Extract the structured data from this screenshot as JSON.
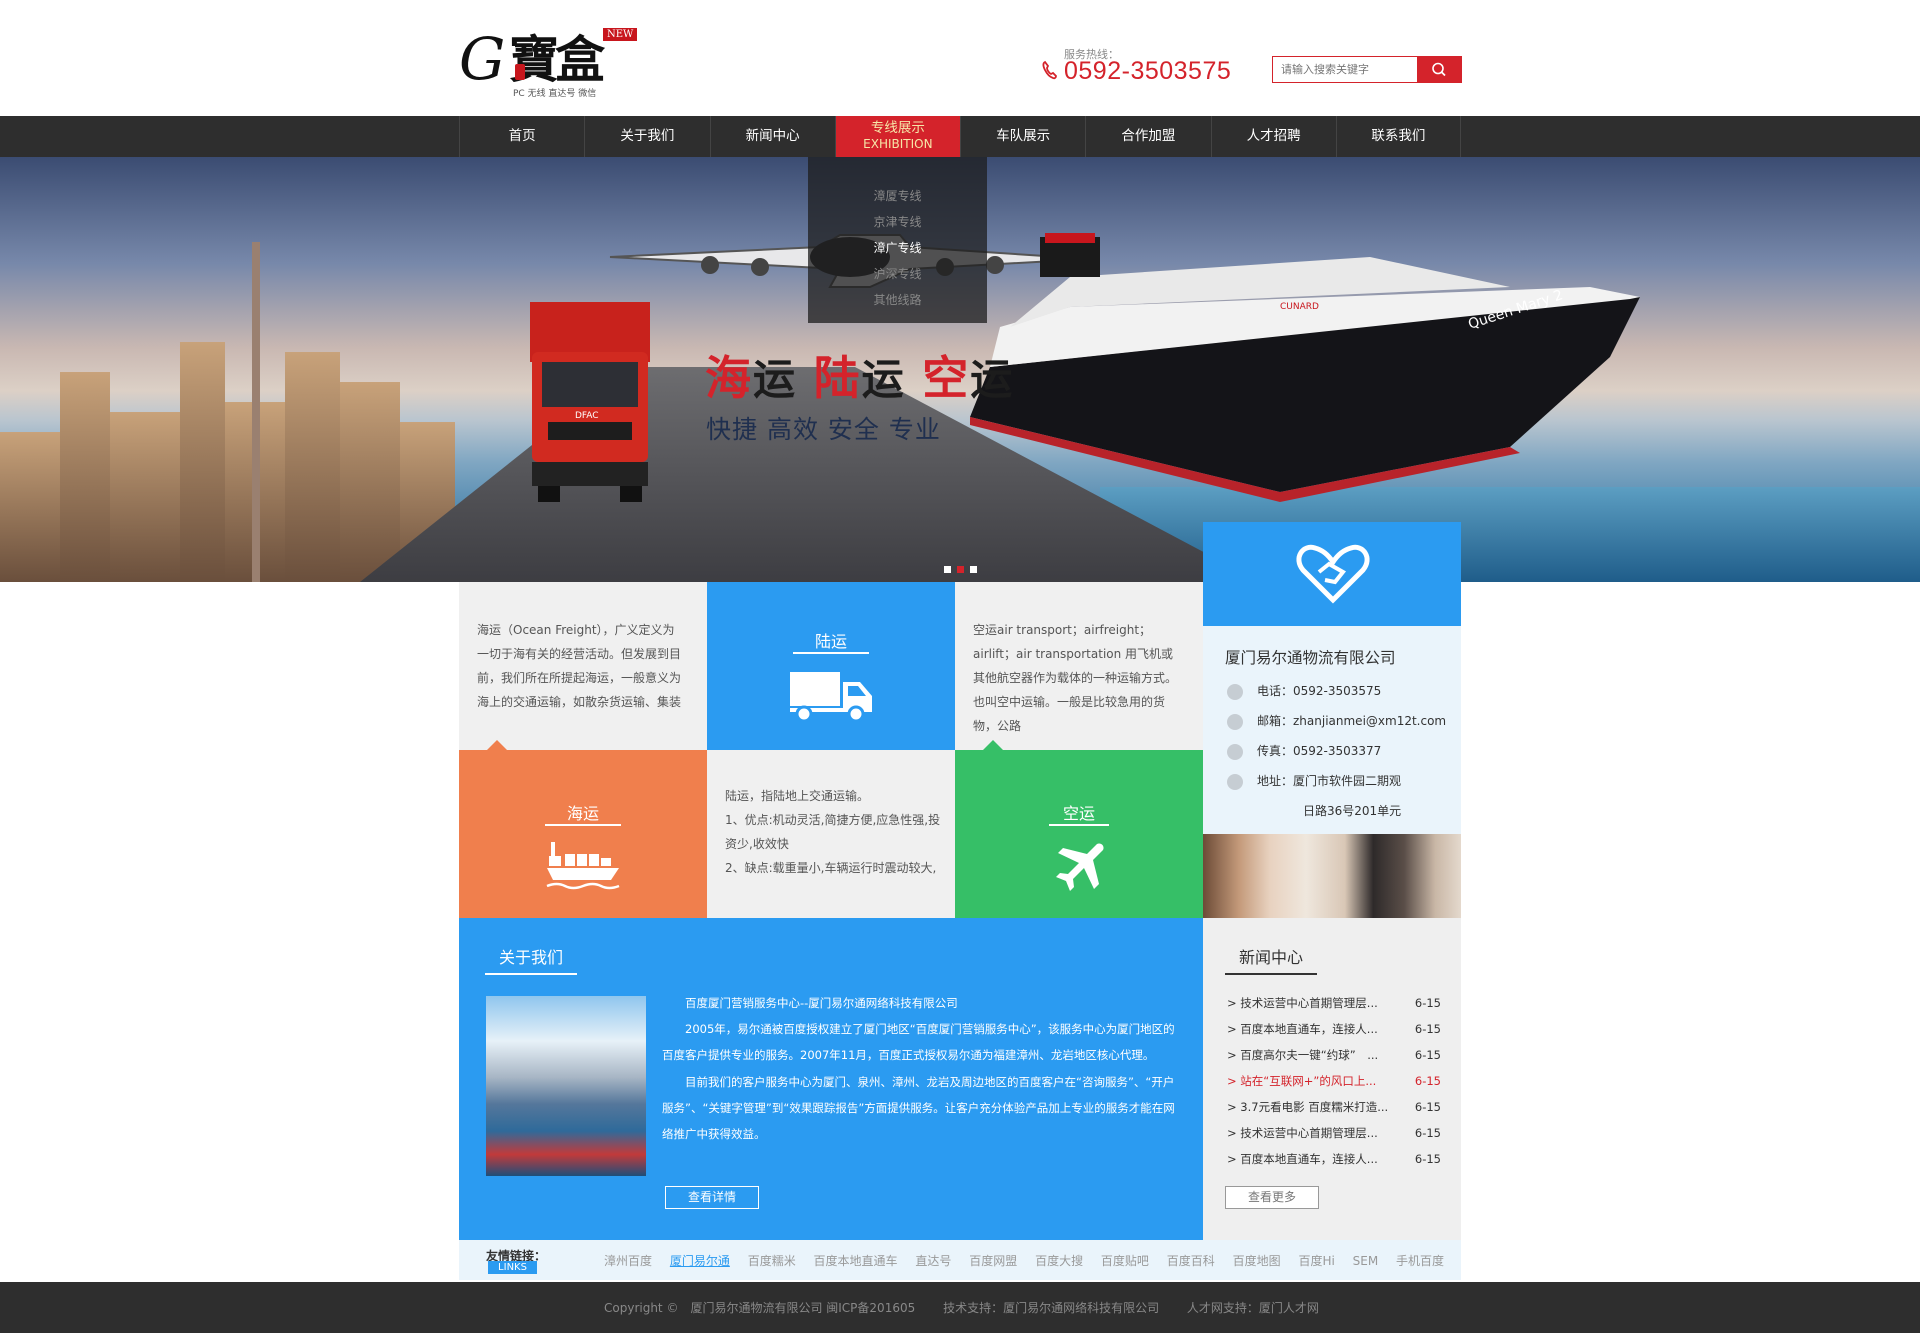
{
  "header": {
    "logo_new": "NEW",
    "logo_letter": "G",
    "logo_word": "寶盒",
    "logo_sub": "PC 无线 直达号 微信",
    "hotline_label": "服务热线：",
    "hotline_number": "0592-3503575",
    "search_placeholder": "请输入搜索关键字"
  },
  "nav": {
    "items": [
      "首页",
      "关于我们",
      "新闻中心",
      "专线展示",
      "车队展示",
      "合作加盟",
      "人才招聘",
      "联系我们"
    ],
    "active_sub": "EXHIBITION",
    "dropdown": [
      "漳厦专线",
      "京津专线",
      "漳广专线",
      "沪深专线",
      "其他线路"
    ]
  },
  "banner": {
    "line1": [
      "海",
      "运",
      "陆",
      "运",
      "空",
      "运"
    ],
    "line2": "快捷 高效 安全 专业",
    "ship_name": "Queen Mary 2",
    "ship_brand": "CUNARD",
    "truck_brand": "DFAC"
  },
  "grid": {
    "sea_text": "海运（Ocean Freight），广义定义为一切于海有关的经营活动。但发展到目前，我们所在所提起海运，一般意义为海上的交通运输，如散杂货运输、集装",
    "land_title": "陆运",
    "air_text": "空运air transport；airfreight；airlift；air transportation 用飞机或其他航空器作为载体的一种运输方式。也叫空中运输。一般是比较急用的货物，公路",
    "sea_title": "海运",
    "land_text_1": "陆运，指陆地上交通运输。",
    "land_text_2": "1、优点:机动灵活,简捷方便,应急性强,投资少,收效快",
    "land_text_3": "2、缺点:载重量小,车辆运行时震动较大,",
    "air_title": "空运"
  },
  "contact": {
    "company": "厦门易尔通物流有限公司",
    "phone": "电话：0592-3503575",
    "email": "邮箱：zhanjianmei@xm12t.com",
    "fax": "传真：0592-3503377",
    "address_1": "地址：厦门市软件园二期观",
    "address_2": "日路36号201单元"
  },
  "about": {
    "title": "关于我们",
    "heading": "百度厦门营销服务中心--厦门易尔通网络科技有限公司",
    "p1": "2005年，易尔通被百度授权建立了厦门地区“百度厦门营销服务中心”，该服务中心为厦门地区的百度客户提供专业的服务。2007年11月，百度正式授权易尔通为福建漳州、龙岩地区核心代理。",
    "p2": "目前我们的客户服务中心为厦门、泉州、漳州、龙岩及周边地区的百度客户在“咨询服务”、“开户服务”、“关键字管理”到“效果跟踪报告”方面提供服务。让客户充分体验产品加上专业的服务才能在网络推广中获得效益。",
    "more": "查看详情"
  },
  "news": {
    "title": "新闻中心",
    "items": [
      {
        "title": "> 技术运营中心首期管理层...",
        "date": "6-15"
      },
      {
        "title": "> 百度本地直通车，连接人...",
        "date": "6-15"
      },
      {
        "title": "> 百度高尔夫一键“约球”　...",
        "date": "6-15"
      },
      {
        "title": "> 站在“互联网+”的风口上...",
        "date": "6-15"
      },
      {
        "title": "> 3.7元看电影 百度糯米打造...",
        "date": "6-15"
      },
      {
        "title": "> 技术运营中心首期管理层...",
        "date": "6-15"
      },
      {
        "title": "> 百度本地直通车，连接人...",
        "date": "6-15"
      }
    ],
    "more": "查看更多"
  },
  "links": {
    "label": "友情链接：",
    "tag": "LINKS",
    "items": [
      "漳州百度",
      "厦门易尔通",
      "百度糯米",
      "百度本地直通车",
      "直达号",
      "百度网盟",
      "百度大搜",
      "百度贴吧",
      "百度百科",
      "百度地图",
      "百度Hi",
      "SEM",
      "手机百度"
    ]
  },
  "footer": {
    "copyright": "Copyright ©　厦门易尔通物流有限公司 闽ICP备201605",
    "support": "技术支持：厦门易尔通网络科技有限公司",
    "talent": "人才网支持：厦门人才网"
  },
  "colors": {
    "brand_red": "#d4232b",
    "blue": "#2b9bf1",
    "orange": "#f07f4d",
    "green": "#36bf67",
    "nav_bg": "#2e2e2e"
  }
}
